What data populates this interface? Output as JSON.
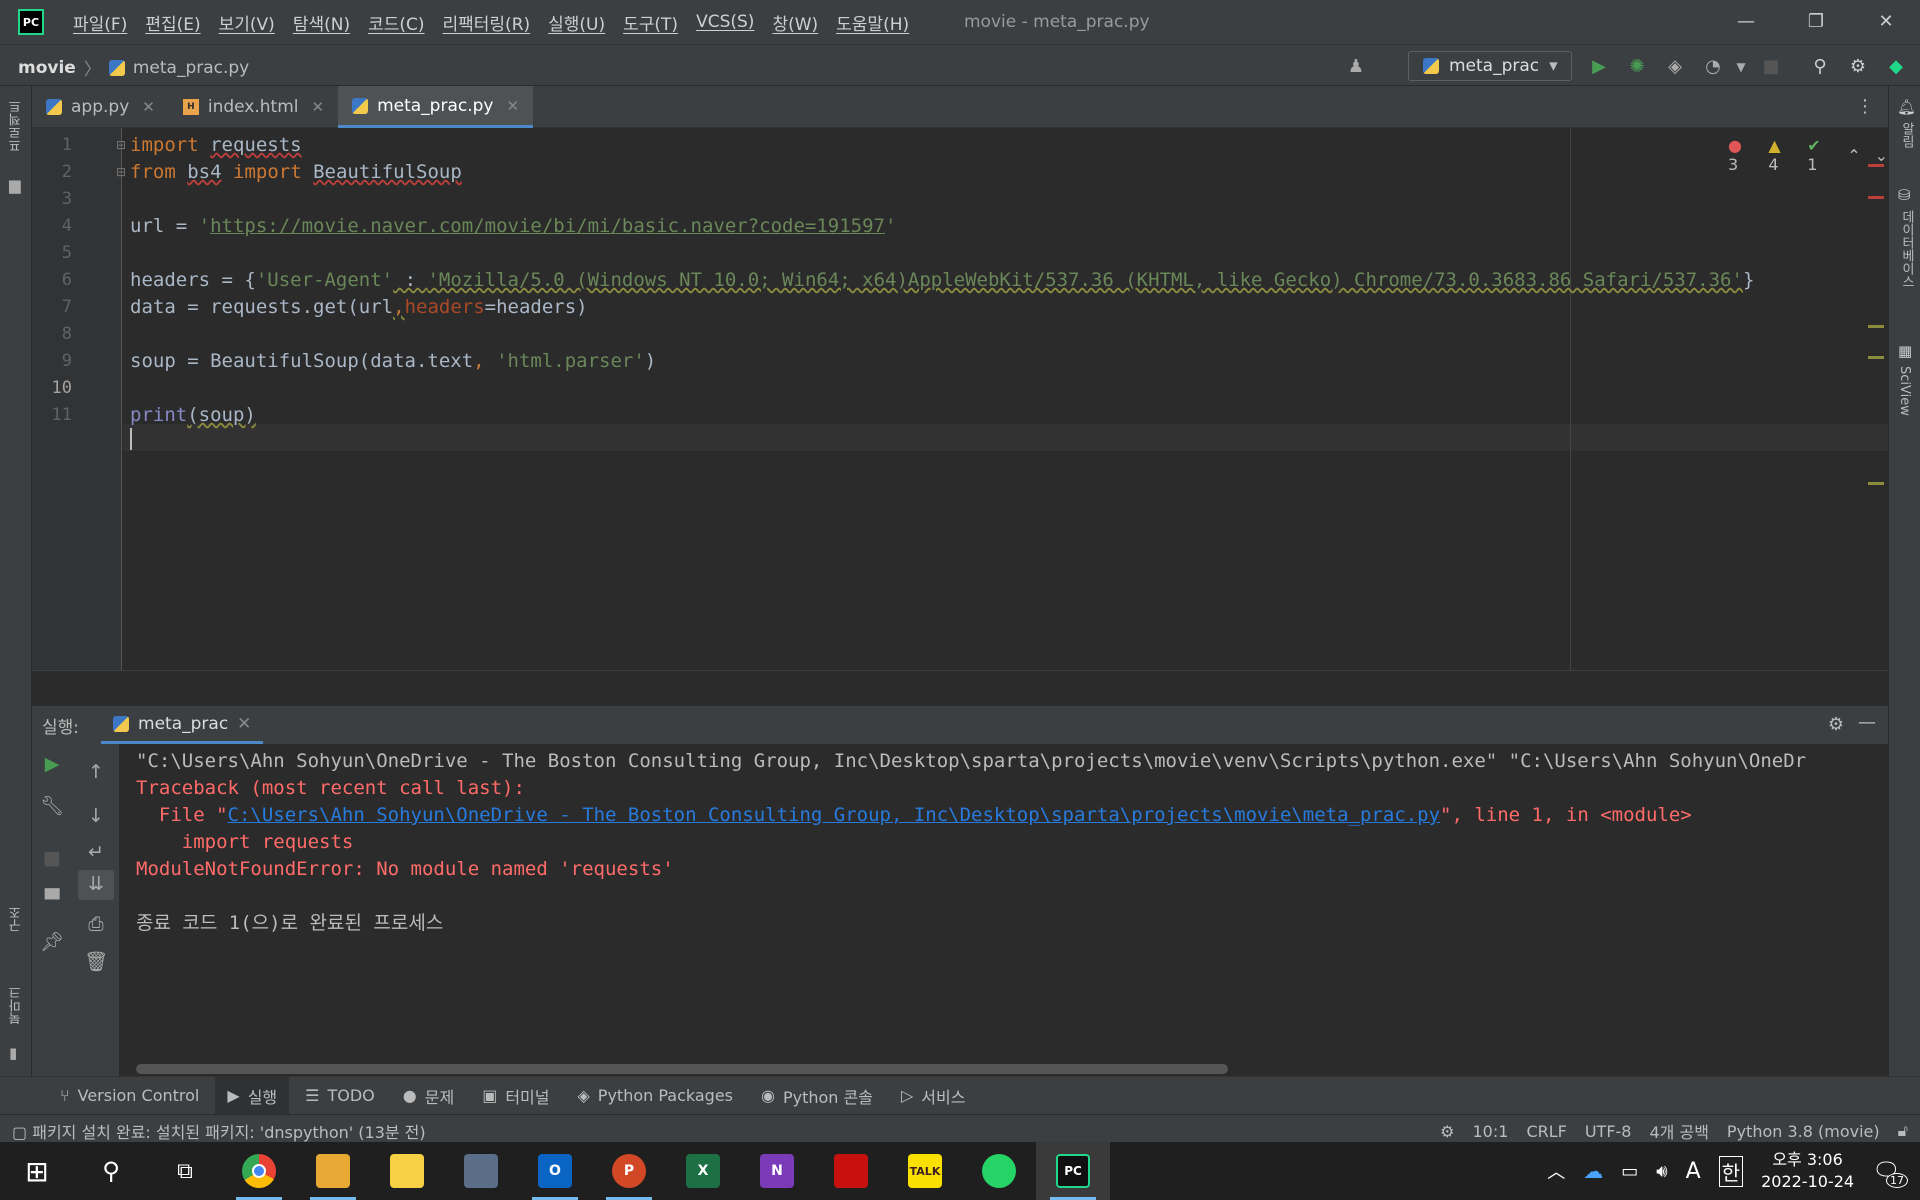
{
  "window": {
    "title": "movie - meta_prac.py",
    "menu": [
      "파일(F)",
      "편집(E)",
      "보기(V)",
      "탐색(N)",
      "코드(C)",
      "리팩터링(R)",
      "실행(U)",
      "도구(T)",
      "VCS(S)",
      "창(W)",
      "도움말(H)"
    ],
    "min_glyph": "—",
    "restore_glyph": "❐",
    "close_glyph": "✕"
  },
  "breadcrumb": {
    "project": "movie",
    "sep": "〉",
    "file": "meta_prac.py"
  },
  "toolbar": {
    "run_config": "meta_prac",
    "dropdown_glyph": "▾"
  },
  "left_stripe": {
    "project": "프로젝트",
    "structure": "구조",
    "bookmarks": "북마크"
  },
  "right_stripe": {
    "notifications": "알림",
    "database": "데이터베이스",
    "sciview": "SciView"
  },
  "tabs": [
    {
      "label": "app.py",
      "close": "✕"
    },
    {
      "label": "index.html",
      "close": "✕"
    },
    {
      "label": "meta_prac.py",
      "close": "✕"
    }
  ],
  "inspections": {
    "errors": "3",
    "warnings": "4",
    "ok": "1",
    "err_glyph": "●",
    "warn_glyph": "▲",
    "ok_glyph": "✔",
    "up": "⌃",
    "down": "⌄"
  },
  "editor": {
    "line_numbers": [
      "1",
      "2",
      "3",
      "4",
      "5",
      "6",
      "7",
      "8",
      "9",
      "10",
      "11"
    ],
    "l1_kw": "import",
    "l1_mod": "requests",
    "l2_kw1": "from",
    "l2_mod": "bs4",
    "l2_kw2": "import",
    "l2_cls": "BeautifulSoup",
    "l4_a": "url = ",
    "l4_q1": "'",
    "l4_url": "https://movie.naver.com/movie/bi/mi/basic.naver?code=191597",
    "l4_q2": "'",
    "l6_a": "headers = {",
    "l6_key": "'User-Agent'",
    "l6_colon": " : ",
    "l6_val": "'Mozilla/5.0 (Windows NT 10.0; Win64; x64)AppleWebKit/537.36 (KHTML, like Gecko) Chrome/73.0.3683.86 Safari/537.36'",
    "l6_end": "}",
    "l7_a": "data = requests.get(url",
    "l7_comma": ",",
    "l7_param": "headers",
    "l7_b": "=headers)",
    "l9_a": "soup = BeautifulSoup(data.text",
    "l9_comma": ", ",
    "l9_str": "'html.parser'",
    "l9_b": ")",
    "l11_fn": "print",
    "l11_a": "(soup)"
  },
  "run_panel": {
    "label": "실행:",
    "tab": "meta_prac",
    "tab_close": "✕"
  },
  "console": {
    "line1": "\"C:\\Users\\Ahn Sohyun\\OneDrive - The Boston Consulting Group, Inc\\Desktop\\sparta\\projects\\movie\\venv\\Scripts\\python.exe\" \"C:\\Users\\Ahn Sohyun\\OneDr",
    "line2": "Traceback (most recent call last):",
    "line3_pre": "  File \"",
    "line3_link": "C:\\Users\\Ahn Sohyun\\OneDrive - The Boston Consulting Group, Inc\\Desktop\\sparta\\projects\\movie\\meta_prac.py",
    "line3_post": "\", line 1, in <module>",
    "line4": "    import requests",
    "line5": "ModuleNotFoundError: No module named 'requests'",
    "line7": "종료 코드 1(으)로 완료된 프로세스"
  },
  "bottom_tabs": [
    {
      "icon": "⑂",
      "label": "Version Control"
    },
    {
      "icon": "▶",
      "label": "실행"
    },
    {
      "icon": "☰",
      "label": "TODO"
    },
    {
      "icon": "●",
      "label": "문제"
    },
    {
      "icon": "▣",
      "label": "터미널"
    },
    {
      "icon": "◈",
      "label": "Python Packages"
    },
    {
      "icon": "◉",
      "label": "Python 콘솔"
    },
    {
      "icon": "▷",
      "label": "서비스"
    }
  ],
  "status": {
    "message": "패키지 설치 완료: 설치된 패키지: 'dnspython' (13분 전)",
    "position": "10:1",
    "line_sep": "CRLF",
    "encoding": "UTF-8",
    "indent": "4개 공백",
    "interpreter": "Python 3.8 (movie)"
  },
  "taskbar": {
    "apps": [
      {
        "label": "",
        "color": "#4285f4"
      },
      {
        "label": "",
        "color": "#e8a834"
      },
      {
        "label": "",
        "color": "#f7d046"
      },
      {
        "label": "",
        "color": "#5a6e8a"
      },
      {
        "label": "O",
        "color": "#0a64c4"
      },
      {
        "label": "P",
        "color": "#d24726"
      },
      {
        "label": "X",
        "color": "#1d7044"
      },
      {
        "label": "N",
        "color": "#7b3ab8"
      },
      {
        "label": "",
        "color": "#c8110e"
      },
      {
        "label": "TALK",
        "color": "#f9e000"
      },
      {
        "label": "",
        "color": "#25d366"
      },
      {
        "label": "PC",
        "color": "#111111"
      }
    ],
    "time": "오후 3:06",
    "date": "2022-10-24",
    "ime": "한",
    "ime2": "A",
    "notif_count": "17",
    "caret_glyph": "︿"
  }
}
